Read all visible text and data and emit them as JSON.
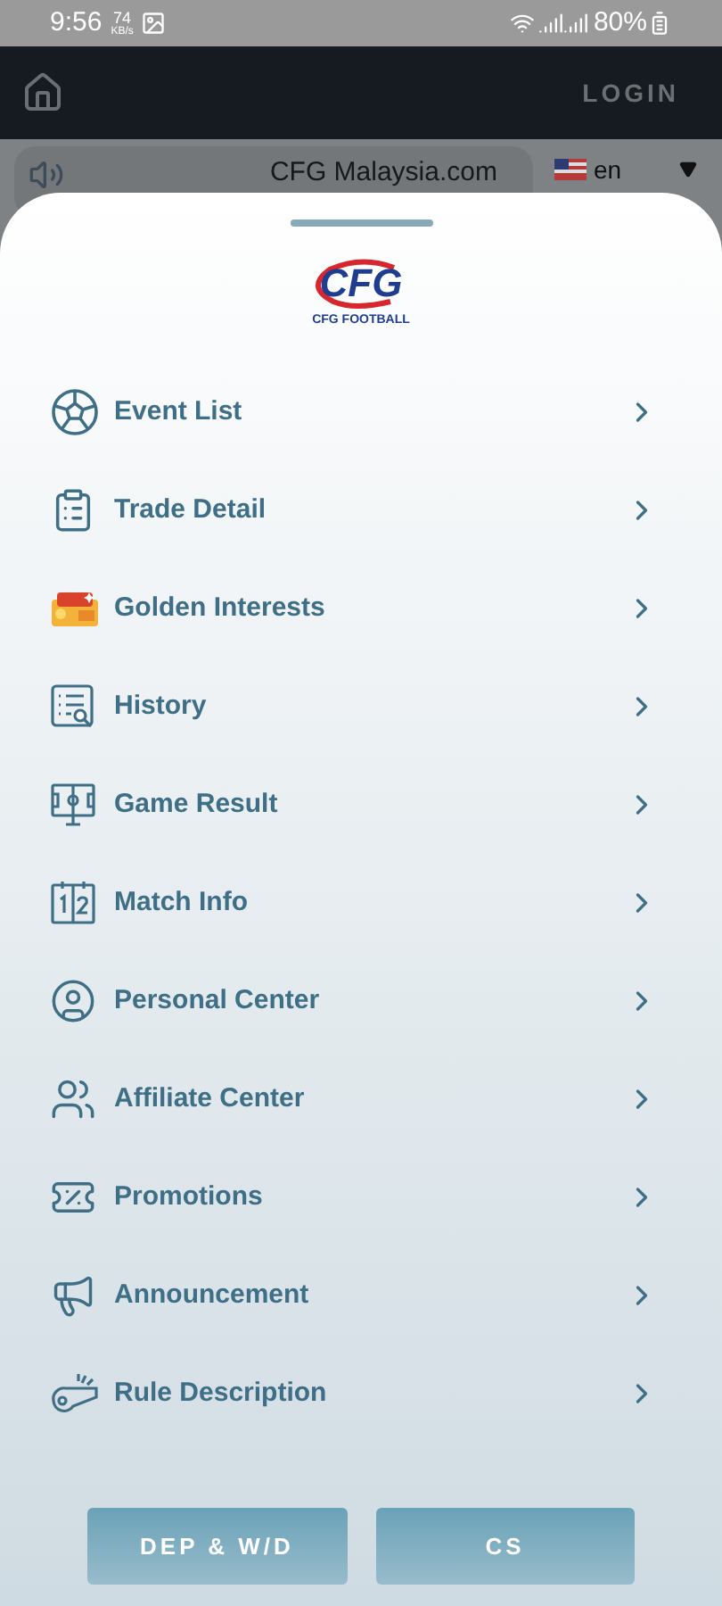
{
  "status_bar": {
    "time": "9:56",
    "speed": "74",
    "speed_unit": "KB/s",
    "battery": "80%"
  },
  "header": {
    "login": "LOGIN"
  },
  "banner": {
    "site": "CFG Malaysia.com",
    "language": "en"
  },
  "menu": {
    "logo": {
      "mark": "CFG",
      "caption": "CFG FOOTBALL"
    },
    "items": [
      {
        "kind": "ball",
        "label": "Event List"
      },
      {
        "kind": "clipboard",
        "label": "Trade Detail"
      },
      {
        "kind": "chest",
        "label": "Golden Interests"
      },
      {
        "kind": "history",
        "label": "History"
      },
      {
        "kind": "pitch",
        "label": "Game Result"
      },
      {
        "kind": "score",
        "label": "Match Info"
      },
      {
        "kind": "person",
        "label": "Personal Center"
      },
      {
        "kind": "group",
        "label": "Affiliate Center"
      },
      {
        "kind": "tag",
        "label": "Promotions"
      },
      {
        "kind": "megaphone",
        "label": "Announcement"
      },
      {
        "kind": "whistle",
        "label": "Rule Description"
      }
    ],
    "buttons": [
      "DEP & W/D",
      "CS"
    ]
  }
}
